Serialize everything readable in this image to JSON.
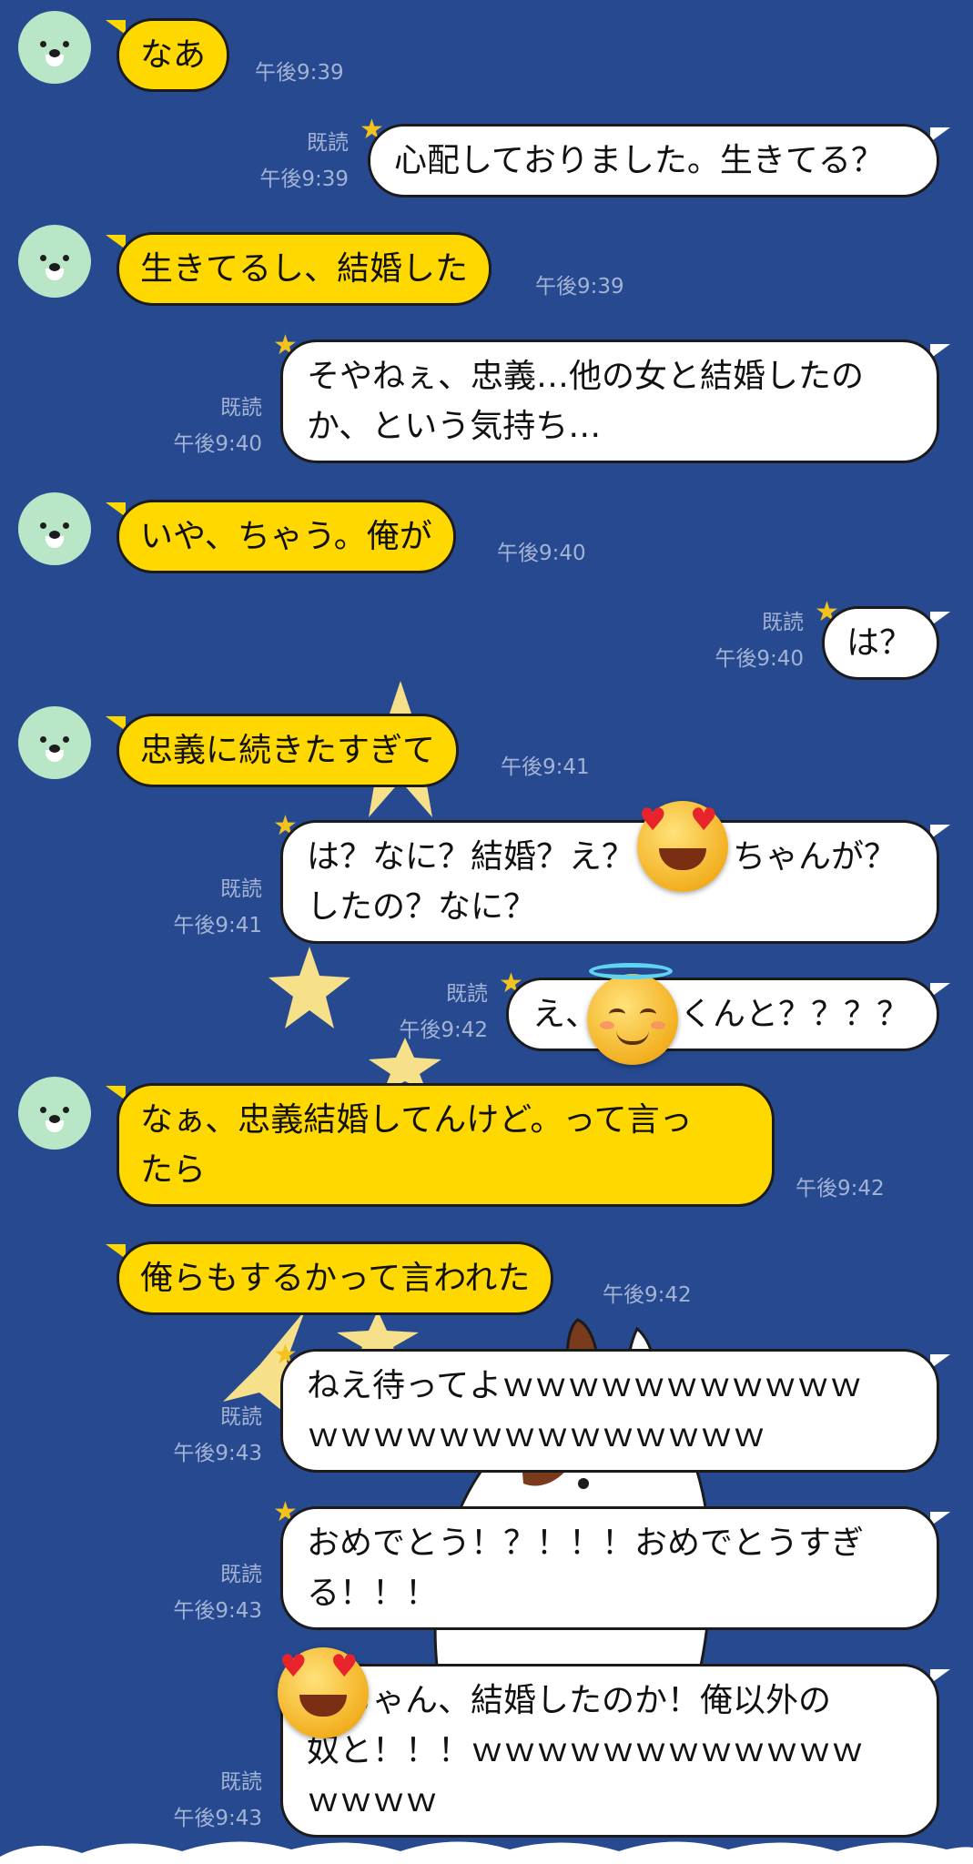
{
  "theme": {
    "background": "#26498f",
    "incoming_bubble": "#ffd800",
    "outgoing_bubble": "#ffffff",
    "meta_text": "#a4b3d4"
  },
  "messages": [
    {
      "text": "なあ",
      "time": "午後9:39"
    },
    {
      "text": "心配しておりました。生きてる？",
      "read": "既読",
      "time": "午後9:39"
    },
    {
      "text": "生きてるし、結婚した",
      "time": "午後9:39"
    },
    {
      "text": "そやねぇ、忠義…他の女と結婚したの\nか、という気持ち…",
      "read": "既読",
      "time": "午後9:40"
    },
    {
      "text": "いや、ちゃう。俺が",
      "time": "午後9:40"
    },
    {
      "text": "は？",
      "read": "既読",
      "time": "午後9:40"
    },
    {
      "text": "忠義に続きたすぎて",
      "time": "午後9:41"
    },
    {
      "text": "は？なに？結婚？え？　　　ちゃんが？\nしたの？なに？",
      "read": "既読",
      "time": "午後9:41"
    },
    {
      "text": "え、　　　くんと？？？？",
      "read": "既読",
      "time": "午後9:42"
    },
    {
      "text": "なぁ、忠義結婚してんけど。って言っ\nたら",
      "time": "午後9:42"
    },
    {
      "text": "俺らもするかって言われた",
      "time": "午後9:42"
    },
    {
      "text": "ねえ待ってよｗｗｗｗｗｗｗｗｗｗｗ\nｗｗｗｗｗｗｗｗｗｗｗｗｗｗ",
      "read": "既読",
      "time": "午後9:43"
    },
    {
      "text": "おめでとう！？！！！おめでとうすぎ\nる！！！",
      "read": "既読",
      "time": "午後9:43"
    },
    {
      "text": "　ちゃん、結婚したのか！俺以外の\n奴と！！！ｗｗｗｗｗｗｗｗｗｗｗｗ\nｗｗｗｗ",
      "read": "既読",
      "time": "午後9:43"
    }
  ],
  "icons": {
    "avatar": "bear-avatar-icon",
    "heart_eyes": "heart-eyes-emoji",
    "halo": "smiling-halo-emoji",
    "star": "star-icon"
  }
}
